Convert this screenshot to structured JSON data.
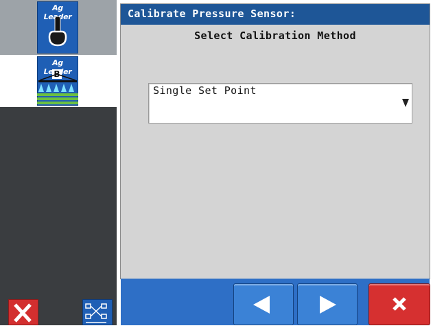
{
  "sidebar": {
    "tiles": [
      {
        "logo": "Ag Leader",
        "icon": "toggle-switch-icon"
      },
      {
        "logo": "Ag Leader",
        "badge": "B",
        "icon": "sprayer-boom-icon"
      }
    ],
    "bottom_buttons": [
      {
        "icon": "close-icon"
      },
      {
        "icon": "network-icon"
      }
    ]
  },
  "dialog": {
    "title": "Calibrate Pressure Sensor:",
    "subtitle": "Select Calibration Method",
    "method_select": {
      "selected": "Single Set Point",
      "icon": "dropdown-arrow-icon"
    }
  },
  "footer": {
    "buttons": [
      {
        "name": "back",
        "icon": "arrow-left-icon"
      },
      {
        "name": "next",
        "icon": "arrow-right-icon"
      },
      {
        "name": "cancel",
        "icon": "close-icon"
      }
    ]
  },
  "colors": {
    "title_bar": "#1e5697",
    "panel": "#d4d4d4",
    "accent_blue": "#1f5fb5",
    "cancel_red": "#d63030",
    "sidebar_dark": "#3a3d40"
  }
}
